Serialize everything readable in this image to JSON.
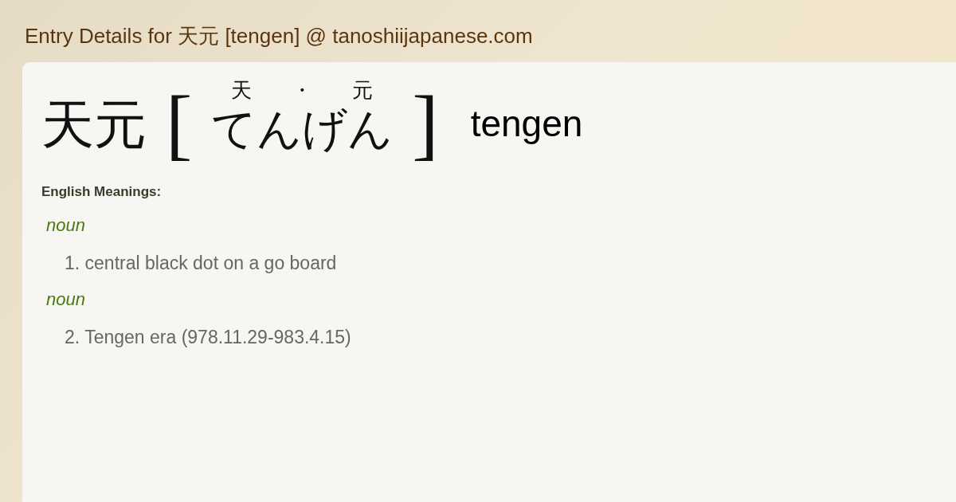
{
  "page_title": "Entry Details for 天元 [tengen] @ tanoshiijapanese.com",
  "entry": {
    "kanji": "天元",
    "bracket_open": "[",
    "furigana": [
      "天",
      "・",
      "元"
    ],
    "kana": "てんげん",
    "bracket_close": "]",
    "romaji": "tengen"
  },
  "meanings_label": "English Meanings:",
  "senses": [
    {
      "pos": "noun",
      "number": "1.",
      "gloss": "central black dot on a go board"
    },
    {
      "pos": "noun",
      "number": "2.",
      "gloss": "Tengen era (978.11.29-983.4.15)"
    }
  ]
}
